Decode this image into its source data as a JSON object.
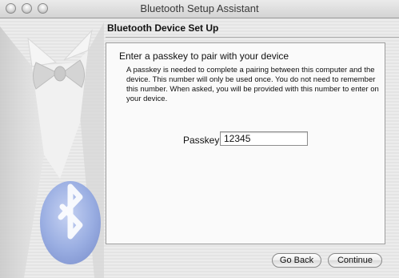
{
  "window": {
    "title": "Bluetooth Setup Assistant"
  },
  "section": {
    "heading": "Bluetooth Device Set Up"
  },
  "panel": {
    "title": "Enter a passkey to pair with your device",
    "description": "A passkey is needed to complete a pairing between this computer and the device. This number will only be used once. You do not need to remember this number. When asked, you will be provided with this number to enter on your device.",
    "passkey_label": "Passkey:",
    "passkey_value": "12345"
  },
  "buttons": {
    "back_label": "Go Back",
    "continue_label": "Continue"
  },
  "colors": {
    "bluetooth_badge": "#8ea2dc",
    "window_background": "#e8e8e8"
  },
  "icons": {
    "art": "tuxedo-bowtie-illustration",
    "badge": "bluetooth-icon"
  }
}
